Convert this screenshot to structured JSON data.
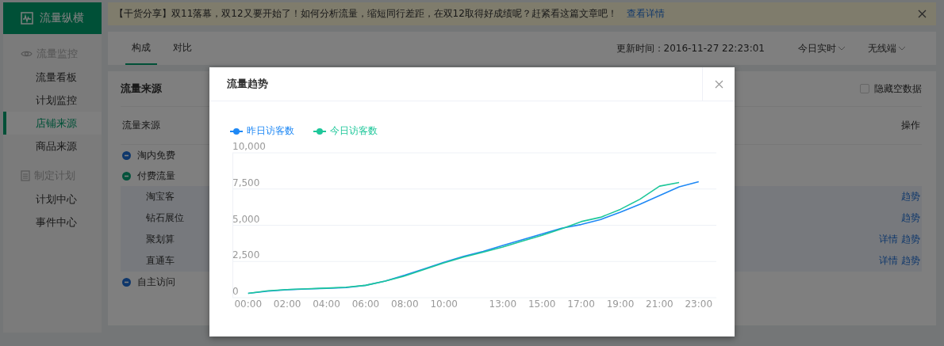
{
  "sidebar": {
    "logo": "流量纵横",
    "groups": [
      {
        "title": "流量监控",
        "items": [
          {
            "label": "流量看板",
            "selected": false
          },
          {
            "label": "计划监控",
            "selected": false
          },
          {
            "label": "店铺来源",
            "selected": true
          },
          {
            "label": "商品来源",
            "selected": false
          }
        ]
      },
      {
        "title": "制定计划",
        "items": [
          {
            "label": "计划中心",
            "selected": false
          },
          {
            "label": "事件中心",
            "selected": false
          }
        ]
      }
    ]
  },
  "notice": {
    "text": "【干货分享】双11落幕，双12又要开始了！如何分析流量，缩短同行差距，在双12取得好成绩呢？赶紧看这篇文章吧！",
    "link": "查看详情"
  },
  "tabs": [
    {
      "label": "构成",
      "selected": true
    },
    {
      "label": "对比",
      "selected": false
    }
  ],
  "update_time": "更新时间：2016-11-27 22:23:01",
  "filters": [
    "今日实时",
    "无线端"
  ],
  "panel": {
    "title": "流量来源",
    "hide_empty": {
      "label": "隐藏空数据",
      "checked": false
    },
    "columns": [
      "流量来源",
      "操作"
    ],
    "rows": [
      {
        "label": "淘内免费",
        "expanded": false
      },
      {
        "label": "付费流量",
        "expanded": true,
        "children": [
          {
            "label": "淘宝客",
            "actions": [
              "趋势"
            ]
          },
          {
            "label": "钻石展位",
            "actions": [
              "趋势"
            ]
          },
          {
            "label": "聚划算",
            "actions": [
              "详情",
              "趋势"
            ]
          },
          {
            "label": "直通车",
            "actions": [
              "详情",
              "趋势"
            ]
          }
        ]
      },
      {
        "label": "自主访问",
        "expanded": false
      }
    ]
  },
  "modal": {
    "title": "流量趋势",
    "chart_data": {
      "type": "line",
      "x": [
        0,
        1,
        2,
        3,
        4,
        5,
        6,
        7,
        8,
        9,
        10,
        11,
        12,
        13,
        14,
        15,
        16,
        17,
        18,
        19,
        20,
        21,
        22,
        23
      ],
      "xticks": [
        {
          "value": 0,
          "label": "00:00"
        },
        {
          "value": 2,
          "label": "02:00"
        },
        {
          "value": 4,
          "label": "04:00"
        },
        {
          "value": 6,
          "label": "06:00"
        },
        {
          "value": 8,
          "label": "08:00"
        },
        {
          "value": 10,
          "label": "10:00"
        },
        {
          "value": 13,
          "label": "13:00"
        },
        {
          "value": 15,
          "label": "15:00"
        },
        {
          "value": 17,
          "label": "17:00"
        },
        {
          "value": 19,
          "label": "19:00"
        },
        {
          "value": 21,
          "label": "21:00"
        },
        {
          "value": 23,
          "label": "23:00"
        }
      ],
      "xlim": [
        -0.8,
        23.9
      ],
      "grid": true,
      "ylim": [
        0,
        10000
      ],
      "yticks": [
        {
          "value": 0,
          "label": "0"
        },
        {
          "value": 2500,
          "label": "2,500"
        },
        {
          "value": 5000,
          "label": "5,000"
        },
        {
          "value": 7500,
          "label": "7,500"
        },
        {
          "value": 10000,
          "label": "10,000"
        }
      ],
      "series": [
        {
          "name": "昨日访客数",
          "color": "#1e88f5",
          "values": [
            300,
            450,
            550,
            600,
            650,
            700,
            850,
            1150,
            1550,
            2000,
            2450,
            2850,
            3200,
            3600,
            4000,
            4400,
            4800,
            5050,
            5400,
            5900,
            6450,
            7050,
            7650,
            8000
          ]
        },
        {
          "name": "今日访客数",
          "color": "#1ec79a",
          "values": [
            300,
            480,
            560,
            620,
            660,
            720,
            850,
            1150,
            1500,
            1950,
            2400,
            2800,
            3150,
            3500,
            3900,
            4300,
            4750,
            5250,
            5550,
            6100,
            6800,
            7700,
            7950,
            null
          ]
        }
      ]
    }
  }
}
